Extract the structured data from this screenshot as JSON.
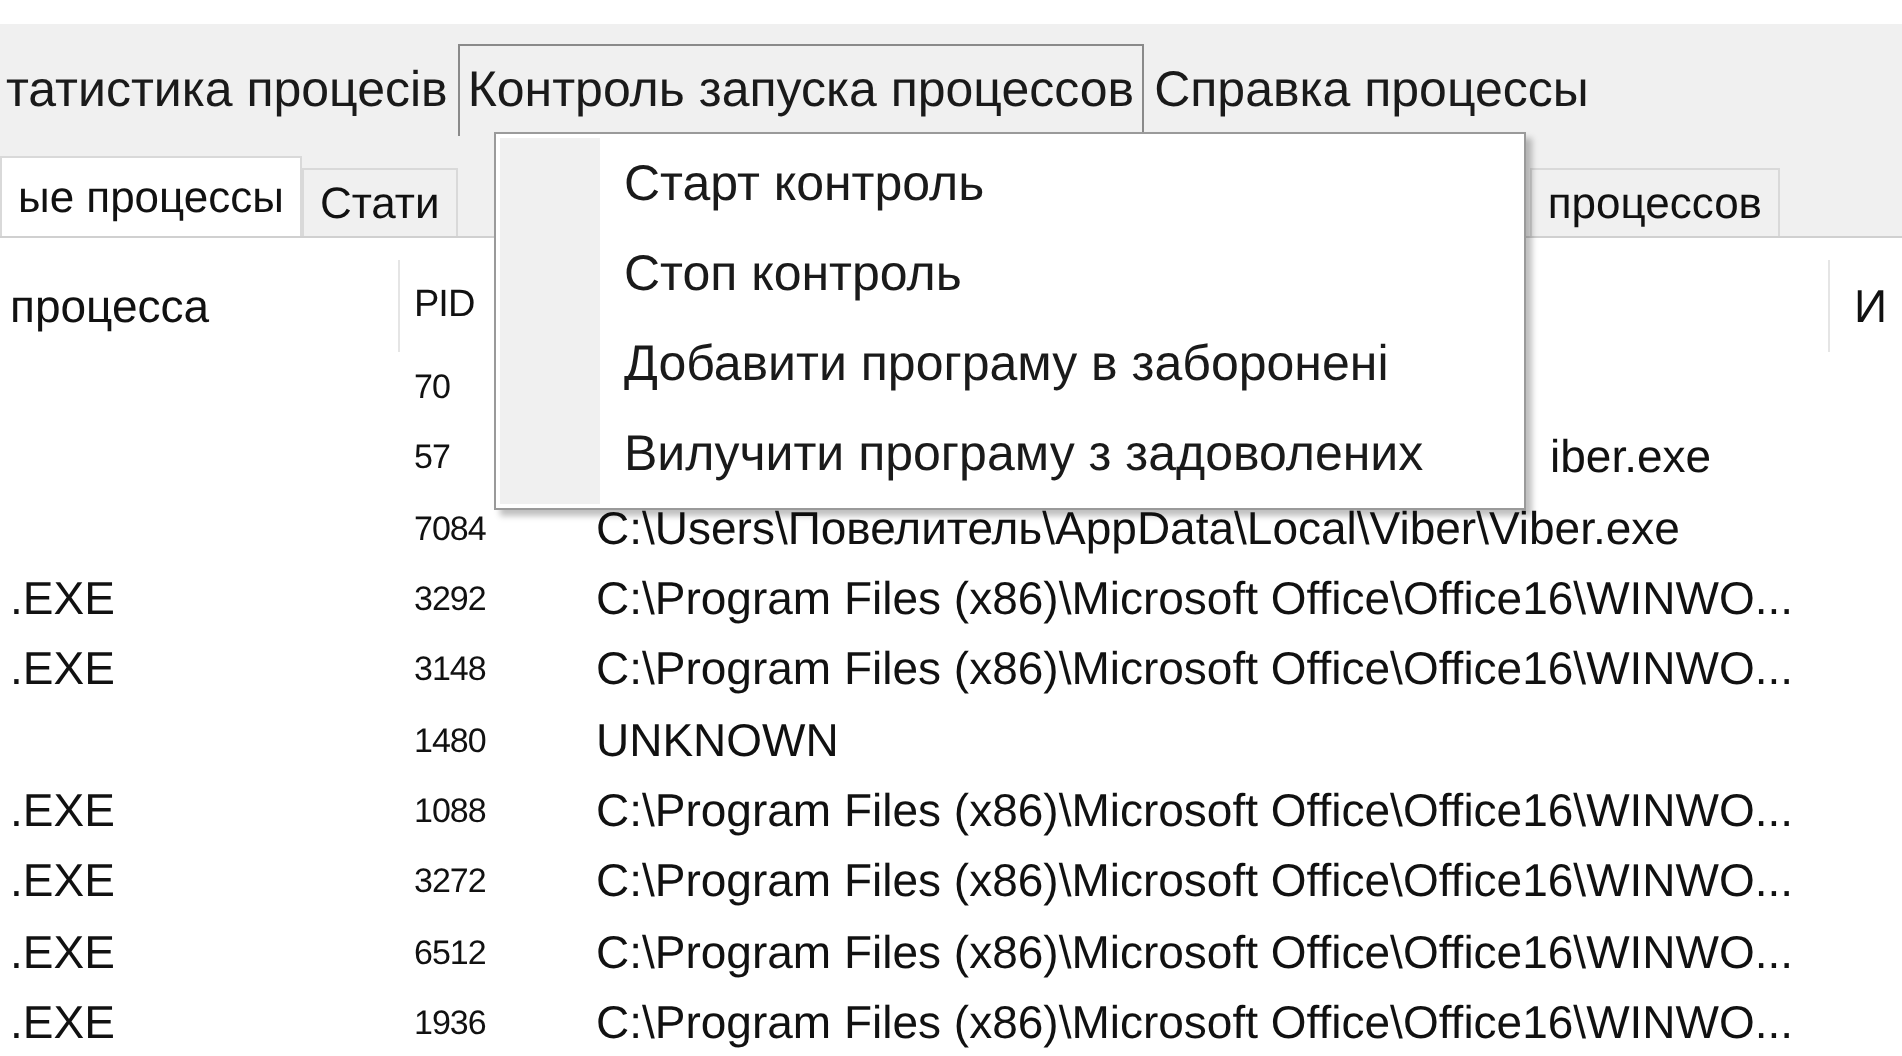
{
  "menu_bar": [
    {
      "label": "татистика процесів",
      "selected": false
    },
    {
      "label": "Контроль запуска процессов",
      "selected": true
    },
    {
      "label": "Справка процессы",
      "selected": false
    }
  ],
  "tabs": [
    {
      "label": "ые процессы",
      "selected": true,
      "covered": false
    },
    {
      "label": "Стати",
      "selected": false,
      "covered": false
    },
    {
      "label": "процессов",
      "selected": false,
      "covered": true
    }
  ],
  "table": {
    "columns": [
      {
        "label": "процесса"
      },
      {
        "label": "PID"
      },
      {
        "covered": true
      },
      {
        "label": "И"
      }
    ],
    "rows": [
      {
        "pid": "70"
      },
      {
        "pid": "57",
        "path": "iber.exe",
        "path_covered": true
      },
      {
        "pid": "7084",
        "path": "C:\\Users\\Повелитель\\AppData\\Local\\Viber\\Viber.exe"
      },
      {
        "name": ".EXE",
        "pid": "3292",
        "path": "C:\\Program Files (x86)\\Microsoft Office\\Office16\\WINWO..."
      },
      {
        "name": ".EXE",
        "pid": "3148",
        "path": "C:\\Program Files (x86)\\Microsoft Office\\Office16\\WINWO..."
      },
      {
        "pid": "1480",
        "path": "UNKNOWN"
      },
      {
        "name": ".EXE",
        "pid": "1088",
        "path": "C:\\Program Files (x86)\\Microsoft Office\\Office16\\WINWO..."
      },
      {
        "name": ".EXE",
        "pid": "3272",
        "path": "C:\\Program Files (x86)\\Microsoft Office\\Office16\\WINWO..."
      },
      {
        "name": ".EXE",
        "pid": "6512",
        "path": "C:\\Program Files (x86)\\Microsoft Office\\Office16\\WINWO..."
      },
      {
        "name": ".EXE",
        "pid": "1936",
        "path": "C:\\Program Files (x86)\\Microsoft Office\\Office16\\WINWO..."
      }
    ]
  },
  "dropdown": {
    "items": [
      "Старт контроль",
      "Стоп контроль",
      "Добавити програму в заборонені",
      "Вилучити програму з задоволених"
    ]
  }
}
